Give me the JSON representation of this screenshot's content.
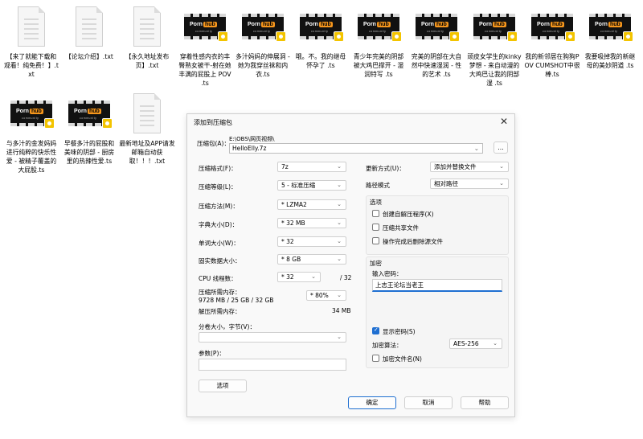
{
  "desktop": {
    "files": [
      {
        "type": "txt",
        "label": "【来了就能下载和观看！纯免费！】.txt"
      },
      {
        "type": "txt",
        "label": "【论坛介绍】.txt"
      },
      {
        "type": "txt",
        "label": "【永久地址发布页】.txt"
      },
      {
        "type": "video",
        "label": "穿着性感内衣的丰臀熟女被干-射在她丰满的屁股上 POV .ts"
      },
      {
        "type": "video",
        "label": "多汁妈妈的伸展洞 - 她为我穿丝袜和内衣.ts"
      },
      {
        "type": "video",
        "label": "哦。不。我的继母怀孕了 .ts"
      },
      {
        "type": "video",
        "label": "青少年完美的阴部被大鸡巴撑开 - 湿润特写 .ts"
      },
      {
        "type": "video",
        "label": "完美的阴部在大自然中快速湿润 - 性的艺术 .ts"
      },
      {
        "type": "video",
        "label": "顽皮女学生的kinky梦想 - 来自动漫的大鸡巴让我的阴部湿 .ts"
      },
      {
        "type": "video",
        "label": "我的新邻居在狗狗POV CUMSHOT中很棒.ts"
      },
      {
        "type": "video",
        "label": "我要吸掉我的新继母的美妙阴道 .ts"
      },
      {
        "type": "video",
        "label": "与多汁的金发妈妈进行纯粹的快乐性爱 - 被精子覆盖的大屁股.ts"
      },
      {
        "type": "video",
        "label": "早餐多汁的屁股和美味的阴部 - 厨房里的热辣性爱.ts"
      },
      {
        "type": "txt",
        "label": "最新地址及APP请发邮箱自动获取！！！.txt"
      }
    ],
    "video_logo_a": "Porn",
    "video_logo_b": "hub",
    "video_logo_sub": "community"
  },
  "dialog": {
    "title": "添加到压缩包",
    "close_icon": "close-icon",
    "archive_label": "压缩包(A)：",
    "archive_path": "E:\\OBS\\网页视频\\",
    "archive_name": "HelloElly.7z",
    "browse_label": "...",
    "format_label": "压缩格式(F)：",
    "format_value": "7z",
    "level_label": "压缩等级(L)：",
    "level_value": "5 - 标准压缩",
    "method_label": "压缩方法(M)：",
    "method_value": "* LZMA2",
    "dict_label": "字典大小(D)：",
    "dict_value": "* 32 MB",
    "word_label": "单词大小(W)：",
    "word_value": "* 32",
    "solid_label": "固实数据大小：",
    "solid_value": "* 8 GB",
    "cpu_label": "CPU 线程数：",
    "cpu_value": "* 32",
    "cpu_total": "/ 32",
    "mem_label": "压缩所需内存：",
    "mem_detail": "9728 MB / 25 GB / 32 GB",
    "mem_percent": "* 80%",
    "decomp_label": "解压所需内存：",
    "decomp_value": "34 MB",
    "split_label": "分卷大小，字节(V)：",
    "split_value": "",
    "params_label": "参数(P)：",
    "params_value": "",
    "options_button": "选项",
    "update_label": "更新方式(U)：",
    "update_value": "添加并替换文件",
    "path_label": "路径模式",
    "path_value": "相对路径",
    "options_group_title": "选项",
    "option_sfx": "创建自解压程序(X)",
    "option_shared": "压缩共享文件",
    "option_delete": "操作完成后删除源文件",
    "encryption_group_title": "加密",
    "password_label": "输入密码：",
    "password_value": "上志王论坛当老王",
    "show_password": "显示密码(S)",
    "enc_method_label": "加密算法：",
    "enc_method_value": "AES-256",
    "encrypt_names": "加密文件名(N)",
    "ok_button": "确定",
    "cancel_button": "取消",
    "help_button": "帮助"
  }
}
